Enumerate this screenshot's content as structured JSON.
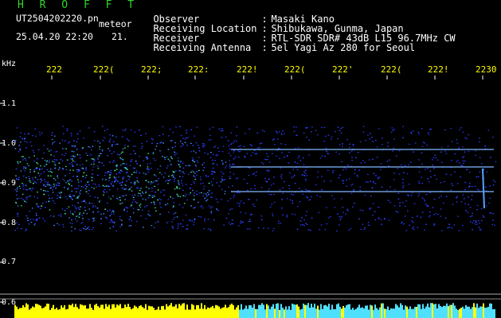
{
  "header": {
    "brand": "H R O F F T",
    "filename": "UT2504202220.pn",
    "tag": "meteor",
    "datetime": "25.04.20 22:20",
    "minute": "21.",
    "info": [
      {
        "key": "Observer",
        "value": "Masaki Kano"
      },
      {
        "key": "Receiving Location",
        "value": "Shibukawa, Gunma, Japan"
      },
      {
        "key": "Receiver",
        "value": "RTL-SDR SDR# 43dB L15 96.7MHz CW"
      },
      {
        "key": "Receiving Antenna",
        "value": "5el Yagi Az 280 for Seoul"
      }
    ]
  },
  "axis": {
    "unit": "kHz",
    "x_ticks": [
      "222",
      "222(",
      "222;",
      "222:",
      "222!",
      "222(",
      "222'",
      "222(",
      "222!",
      "2230"
    ],
    "y_ticks": [
      "1.1",
      "1.0",
      "0.9",
      "0.8",
      "0.7",
      "0.6"
    ]
  },
  "colors": {
    "background": "#000000",
    "brand": "#2fd82f",
    "tick": "#ffff00",
    "noise": "#2a3cff",
    "hot": "#3ff0a0",
    "trace": "#7fb6ff",
    "bar_yellow": "#ffff00",
    "bar_cyan": "#4fe0ff"
  }
}
